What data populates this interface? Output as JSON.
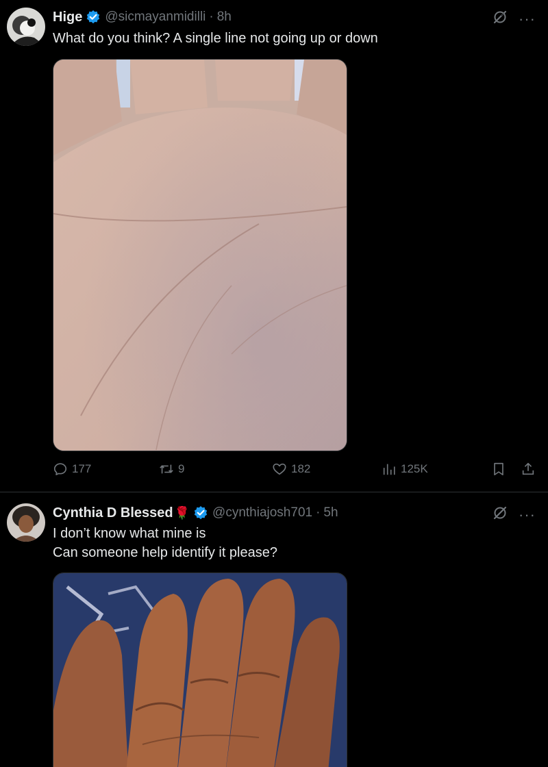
{
  "post1": {
    "author_name": "Hige",
    "handle": "@sicmayanmidilli",
    "separator": "·",
    "time": "8h",
    "text": "What do you think? A single line not going up or down",
    "media": "palm-photo",
    "stats": {
      "replies": "177",
      "reposts": "9",
      "likes": "182",
      "views": "125K"
    }
  },
  "post2": {
    "author_name": "Cynthia D Blessed",
    "name_emoji": "🌹",
    "handle": "@cynthiajosh701",
    "separator": "·",
    "time": "5h",
    "text_line1": "I don’t know what mine is",
    "text_line2": "Can someone help identify it please?",
    "media": "palm-photo"
  },
  "more_glyph": "···",
  "colors": {
    "background": "#000000",
    "text": "#e7e9ea",
    "secondary": "#71767b",
    "verified": "#1d9bf0",
    "divider": "#2f3336"
  }
}
